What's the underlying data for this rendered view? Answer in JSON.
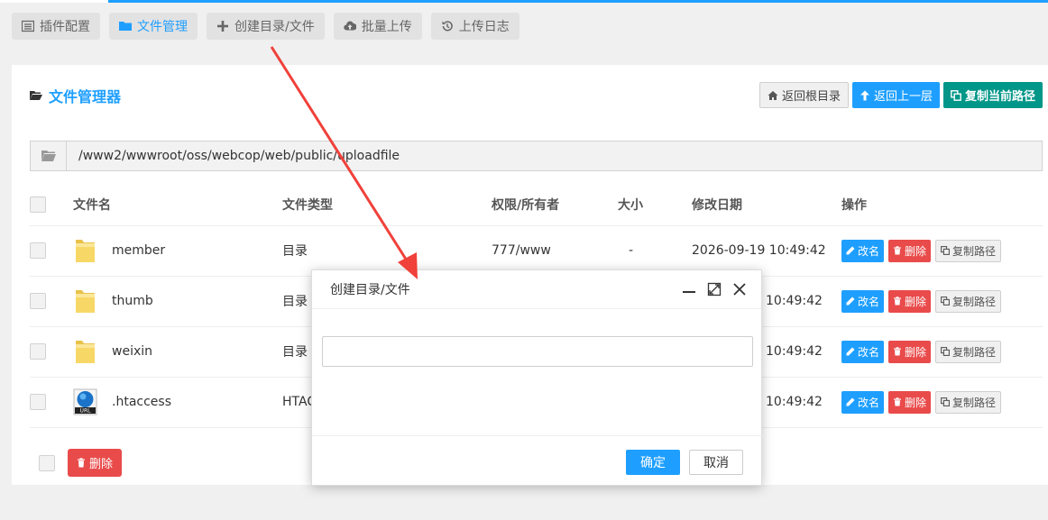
{
  "tabs": [
    {
      "label": "插件配置",
      "icon": "list-icon"
    },
    {
      "label": "文件管理",
      "icon": "folder-icon"
    },
    {
      "label": "创建目录/文件",
      "icon": "plus-icon"
    },
    {
      "label": "批量上传",
      "icon": "cloud-upload-icon"
    },
    {
      "label": "上传日志",
      "icon": "history-icon"
    }
  ],
  "panel": {
    "title": "文件管理器",
    "buttons": {
      "root": "返回根目录",
      "up": "返回上一层",
      "copy_path": "复制当前路径"
    },
    "path": "/www2/wwwroot/oss/webcop/web/public/uploadfile"
  },
  "table": {
    "headers": [
      "文件名",
      "文件类型",
      "权限/所有者",
      "大小",
      "修改日期",
      "操作"
    ],
    "rows": [
      {
        "name": "member",
        "type": "目录",
        "perm": "777/www",
        "size": "-",
        "date": "2026-09-19 10:49:42",
        "icon": "folder-icon"
      },
      {
        "name": "thumb",
        "type": "目录",
        "perm": "",
        "size": "",
        "date": "10:49:42",
        "icon": "folder-icon"
      },
      {
        "name": "weixin",
        "type": "目录",
        "perm": "",
        "size": "",
        "date": "10:49:42",
        "icon": "folder-icon"
      },
      {
        "name": ".htaccess",
        "type": "HTAC",
        "perm": "",
        "size": "",
        "date": "10:49:42",
        "icon": "url-file-icon"
      }
    ],
    "actions": {
      "rename": "改名",
      "delete": "删除",
      "copy": "复制路径"
    }
  },
  "footer": {
    "delete": "删除"
  },
  "dialog": {
    "title": "创建目录/文件",
    "input_value": "",
    "ok": "确定",
    "cancel": "取消"
  },
  "colors": {
    "accent": "#1e9fff",
    "danger": "#e94b4b",
    "teal": "#009688"
  }
}
